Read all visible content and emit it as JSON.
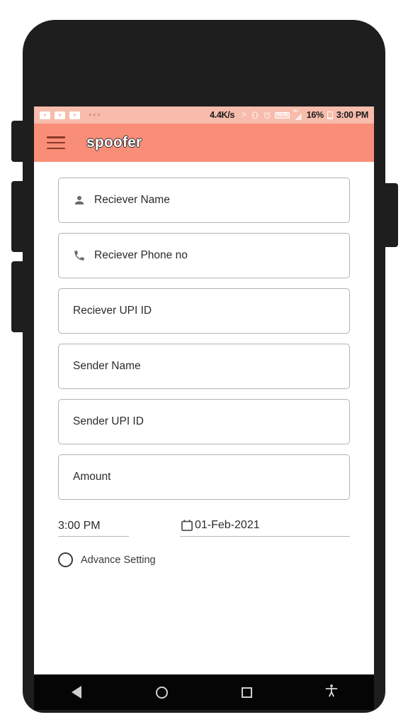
{
  "status_bar": {
    "notification_icons": [
      "youtube-icon",
      "youtube-icon",
      "youtube-icon"
    ],
    "overflow": "•••",
    "network_speed": "4.4K/s",
    "wifi_icon": "wifi-icon",
    "vibrate_icon": "vibrate-icon",
    "alarm_icon": "alarm-icon",
    "volte_label": "VoLTE",
    "network_type": "4G",
    "signal_icon": "signal-bars-icon",
    "battery_percent": "16%",
    "battery_icon": "battery-icon",
    "clock": "3:00 PM",
    "background_color": "#f7bcac"
  },
  "app_bar": {
    "menu_icon": "hamburger-menu-icon",
    "title": "spoofer",
    "background_color": "#f98e78"
  },
  "form": {
    "fields": [
      {
        "label": "Reciever Name",
        "icon": "person-icon",
        "has_icon": true
      },
      {
        "label": "Reciever Phone no",
        "icon": "phone-icon",
        "has_icon": true
      },
      {
        "label": "Reciever UPI ID",
        "icon": "",
        "has_icon": false
      },
      {
        "label": "Sender Name",
        "icon": "",
        "has_icon": false
      },
      {
        "label": "Sender UPI ID",
        "icon": "",
        "has_icon": false
      },
      {
        "label": "Amount",
        "icon": "",
        "has_icon": false
      }
    ]
  },
  "datetime": {
    "time_value": "3:00 PM",
    "calendar_icon": "calendar-icon",
    "date_value": "01-Feb-2021"
  },
  "advance_setting": {
    "radio_icon": "radio-unchecked-icon",
    "label": "Advance Setting",
    "checked": false
  },
  "nav_bar": {
    "back": "back-triangle-icon",
    "home": "home-circle-icon",
    "recents": "recents-square-icon",
    "accessibility": "accessibility-icon"
  }
}
